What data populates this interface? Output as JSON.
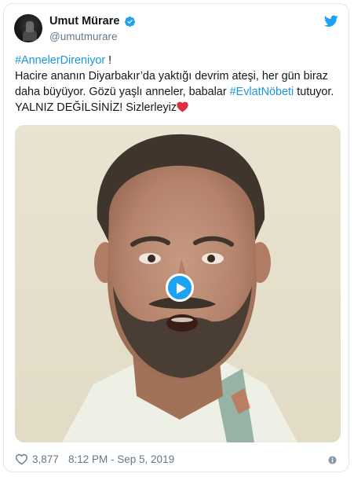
{
  "author": {
    "name": "Umut Mürare",
    "handle": "@umutmurare",
    "verified": true
  },
  "tweet": {
    "hashtag1": "#AnnelerDireniyor",
    "after_hashtag1": " !",
    "line_a": "Hacire ananın Diyarbakır’da yaktığı devrim ateşi, her gün biraz daha büyüyor. Gözü yaşlı anneler, babalar ",
    "hashtag2": "#EvlatNöbeti",
    "line_b": " tutuyor.",
    "line_c": "YALNIZ DEĞİLSİNİZ! Sizlerleyiz"
  },
  "media": {
    "type": "video",
    "play_icon": "play-icon"
  },
  "footer": {
    "like_count": "3,877",
    "timestamp": "8:12 PM - Sep 5, 2019"
  },
  "colors": {
    "link": "#1b95e0",
    "brand": "#1da1f2",
    "text": "#14171a",
    "secondary": "#657786",
    "heart": "#e0245e"
  }
}
